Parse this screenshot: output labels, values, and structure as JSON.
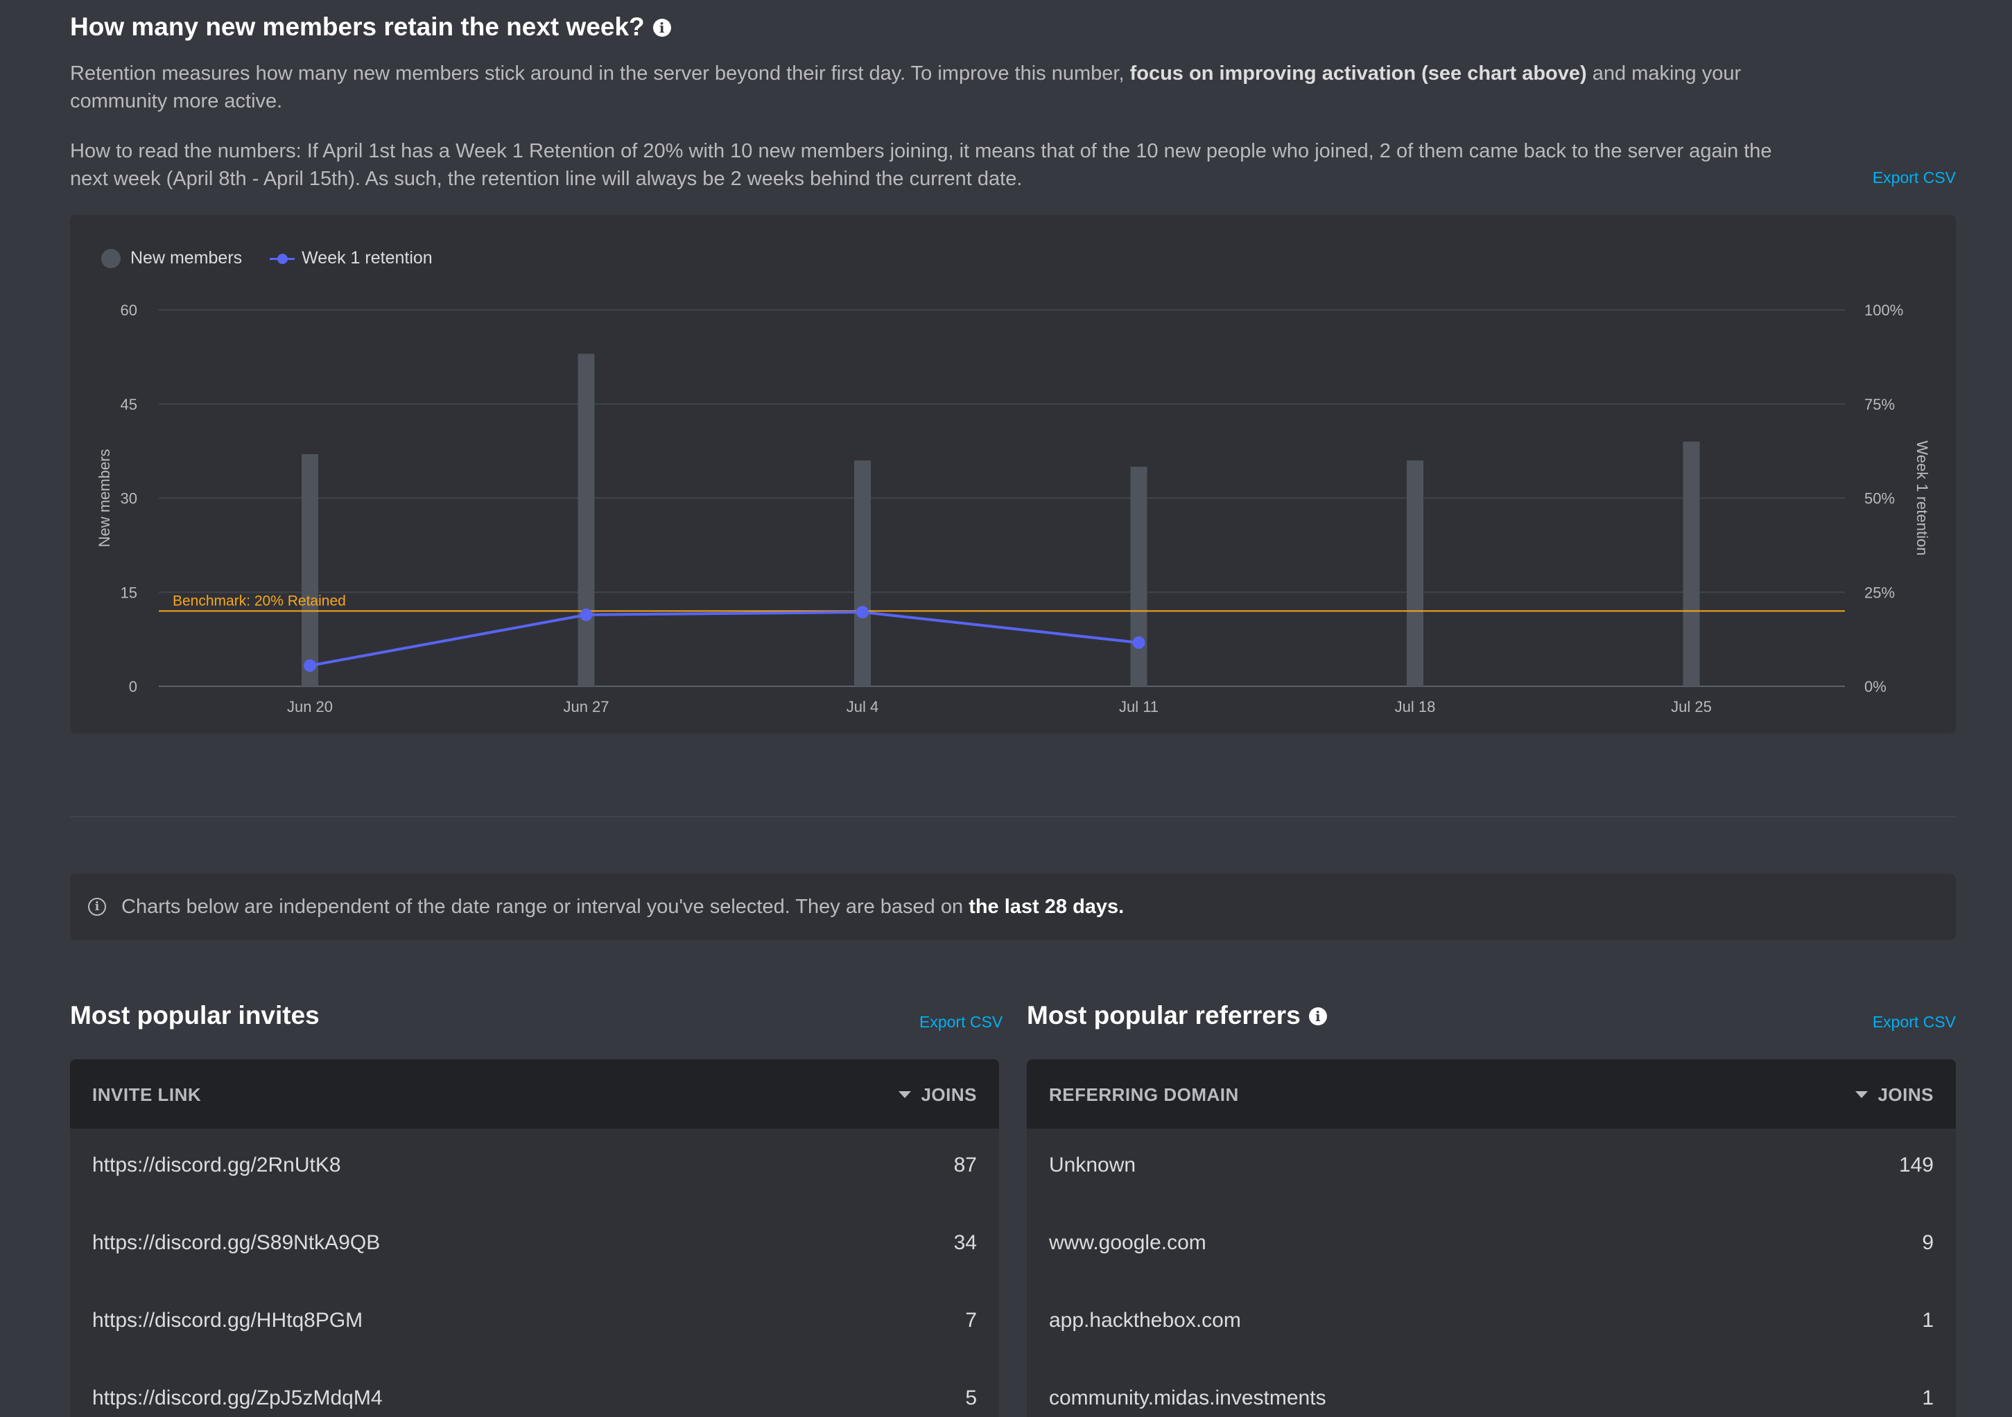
{
  "retention": {
    "title": "How many new members retain the next week?",
    "info_glyph": "i",
    "desc1_pre": "Retention measures how many new members stick around in the server beyond their first day. To improve this number, ",
    "desc1_bold": "focus on improving activation (see chart above)",
    "desc1_post": " and making your",
    "desc1_line2": "community more active.",
    "desc2_line1": "How to read the numbers: If April 1st has a Week 1 Retention of 20% with 10 new members joining, it means that of the 10 new people who joined, 2 of them came back to the server again the",
    "desc2_line2": "next week (April 8th - April 15th). As such, the retention line will always be 2 weeks behind the current date.",
    "export_label": "Export CSV"
  },
  "chart_data": {
    "type": "bar",
    "categories": [
      "Jun 20",
      "Jun 27",
      "Jul 4",
      "Jul 11",
      "Jul 18",
      "Jul 25"
    ],
    "series": [
      {
        "name": "New members",
        "type": "bar",
        "axis": "left",
        "values": [
          37,
          53,
          36,
          35,
          36,
          39
        ],
        "color": "#4f545c"
      },
      {
        "name": "Week 1 retention",
        "type": "line",
        "axis": "right",
        "values": [
          5.5,
          19,
          19.7,
          11.6,
          null,
          null
        ],
        "color": "#5865f2"
      }
    ],
    "ylabel": "New members",
    "ylabel_right": "Week 1 retention",
    "ylim": [
      0,
      60
    ],
    "ylim_right": [
      0,
      100
    ],
    "yticks": [
      "0",
      "15",
      "30",
      "45",
      "60"
    ],
    "yticks_right": [
      "0%",
      "25%",
      "50%",
      "75%",
      "100%"
    ],
    "yticks_values": [
      0,
      15,
      30,
      45,
      60
    ],
    "benchmark": {
      "label": "Benchmark: 20% Retained",
      "value": 20,
      "color": "#faa61a"
    },
    "legend_position": "top-left",
    "grid": true
  },
  "notice": {
    "text": "Charts below are independent of the date range or interval you've selected. They are based on ",
    "bold": "the last 28 days."
  },
  "invites": {
    "title": "Most popular invites",
    "export_label": "Export CSV",
    "col1": "INVITE LINK",
    "col2": "JOINS",
    "rows": [
      {
        "link": "https://discord.gg/2RnUtK8",
        "joins": "87"
      },
      {
        "link": "https://discord.gg/S89NtkA9QB",
        "joins": "34"
      },
      {
        "link": "https://discord.gg/HHtq8PGM",
        "joins": "7"
      },
      {
        "link": "https://discord.gg/ZpJ5zMdqM4",
        "joins": "5"
      }
    ]
  },
  "referrers": {
    "title": "Most popular referrers",
    "export_label": "Export CSV",
    "col1": "REFERRING DOMAIN",
    "col2": "JOINS",
    "rows": [
      {
        "domain": "Unknown",
        "joins": "149"
      },
      {
        "domain": "www.google.com",
        "joins": "9"
      },
      {
        "domain": "app.hackthebox.com",
        "joins": "1"
      },
      {
        "domain": "community.midas.investments",
        "joins": "1"
      }
    ]
  }
}
